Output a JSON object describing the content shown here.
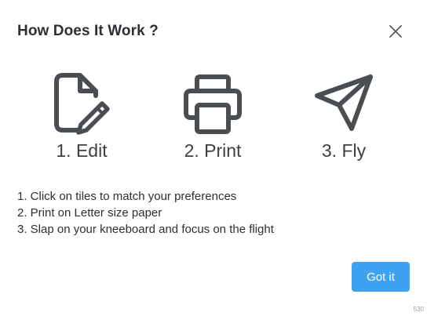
{
  "dialog": {
    "title": "How Does It Work ?",
    "close_icon": "close-icon"
  },
  "steps": [
    {
      "label": "1. Edit",
      "icon": "edit-document-icon"
    },
    {
      "label": "2. Print",
      "icon": "printer-icon"
    },
    {
      "label": "3. Fly",
      "icon": "paper-plane-icon"
    }
  ],
  "instructions": [
    "1. Click on tiles to match your preferences",
    "2. Print on Letter size paper",
    "3. Slap on your kneeboard and focus on the flight"
  ],
  "footer": {
    "got_it_label": "Got it",
    "corner_note": "530"
  },
  "colors": {
    "accent": "#3ea2f2",
    "icon": "#4a4d51"
  }
}
